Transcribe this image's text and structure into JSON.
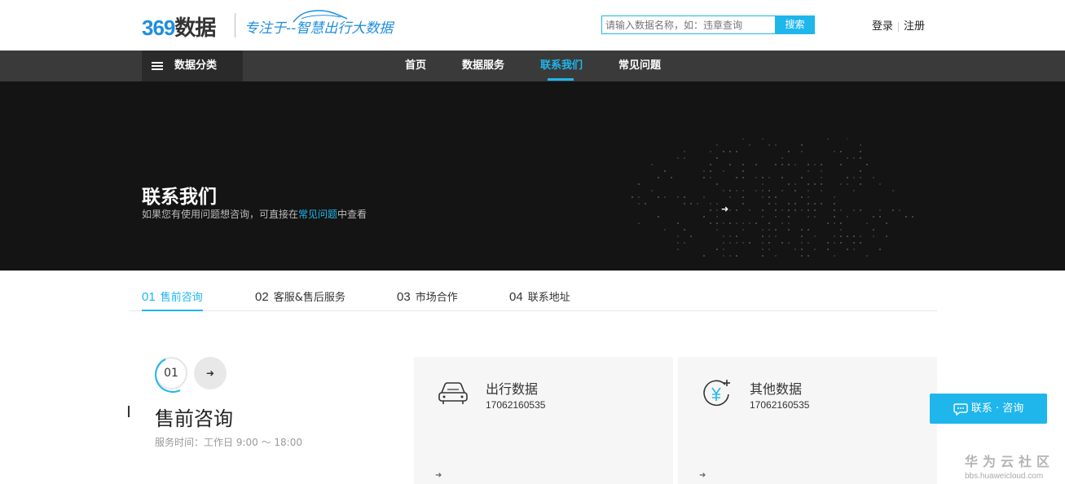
{
  "header": {
    "logo_number": "369",
    "logo_text": "数据",
    "slogan": "专注于--智慧出行大数据",
    "search": {
      "placeholder": "请输入数据名称，如：违章查询",
      "button_label": "搜索"
    },
    "login_label": "登录",
    "register_label": "注册"
  },
  "nav": {
    "category_label": "数据分类",
    "items": [
      {
        "label": "首页"
      },
      {
        "label": "数据服务"
      },
      {
        "label": "联系我们",
        "active": true
      },
      {
        "label": "常见问题"
      }
    ]
  },
  "hero": {
    "title": "联系我们",
    "subtitle_before": "如果您有使用问题想咨询，可直接在",
    "subtitle_link": "常见问题",
    "subtitle_after": "中查看",
    "arrow": "➜"
  },
  "tabs": [
    {
      "num": "01",
      "label": "售前咨询",
      "active": true
    },
    {
      "num": "02",
      "label": "客服&售后服务"
    },
    {
      "num": "03",
      "label": "市场合作"
    },
    {
      "num": "04",
      "label": "联系地址"
    }
  ],
  "section": {
    "number": "01",
    "arrow": "➜",
    "title": "售前咨询",
    "hours": "服务时间：工作日 9:00 ～ 18:00"
  },
  "cards": [
    {
      "icon": "car-icon",
      "title": "出行数据",
      "phone": "17062160535",
      "arrow": "➜"
    },
    {
      "icon": "yen-icon",
      "title": "其他数据",
      "phone": "17062160535",
      "arrow": "➜"
    }
  ],
  "float_button": {
    "label": "联系 · 咨询"
  },
  "watermark": {
    "title": "华为云社区",
    "url": "bbs.huaweicloud.com"
  },
  "colors": {
    "accent": "#1fb6ec",
    "logo_blue": "#1f8ee0",
    "nav_bg": "#3a3a3a",
    "hero_bg": "#141414"
  }
}
